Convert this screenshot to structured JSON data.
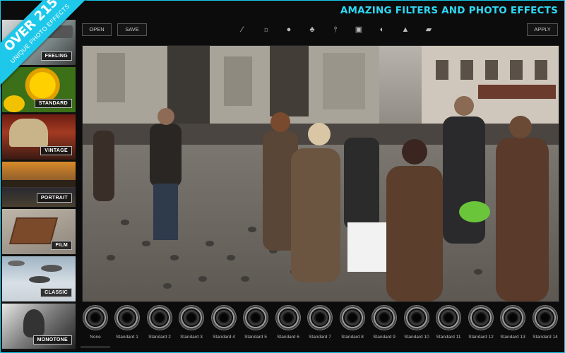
{
  "banner": {
    "title": "AMAZING FILTERS AND PHOTO EFFECTS"
  },
  "ribbon": {
    "big": "OVER 215",
    "small": "UNIQUE PHOTO EFFECTS"
  },
  "toolbar": {
    "open_label": "OPEN",
    "save_label": "SAVE",
    "apply_label": "APPLY",
    "icons": [
      "magic-wand-icon",
      "sun-icon",
      "drop-icon",
      "leaf-icon",
      "thermometer-icon",
      "vignette-icon",
      "contrast-icon",
      "triangle-icon",
      "texture-icon"
    ]
  },
  "categories": [
    {
      "label": "FEELING"
    },
    {
      "label": "STANDARD"
    },
    {
      "label": "VINTAGE"
    },
    {
      "label": "PORTRAIT"
    },
    {
      "label": "FILM"
    },
    {
      "label": "CLASSIC"
    },
    {
      "label": "MONOTONE"
    }
  ],
  "filters": [
    "None",
    "Standard 1",
    "Standard 2",
    "Standard 3",
    "Standard 4",
    "Standard 5",
    "Standard 6",
    "Standard 7",
    "Standard 8",
    "Standard 9",
    "Standard 10",
    "Standard 11",
    "Standard 12",
    "Standard 13",
    "Standard 14"
  ],
  "selected_filter": "None",
  "colors": {
    "accent": "#1ec8ea",
    "background": "#0c0c0c"
  }
}
